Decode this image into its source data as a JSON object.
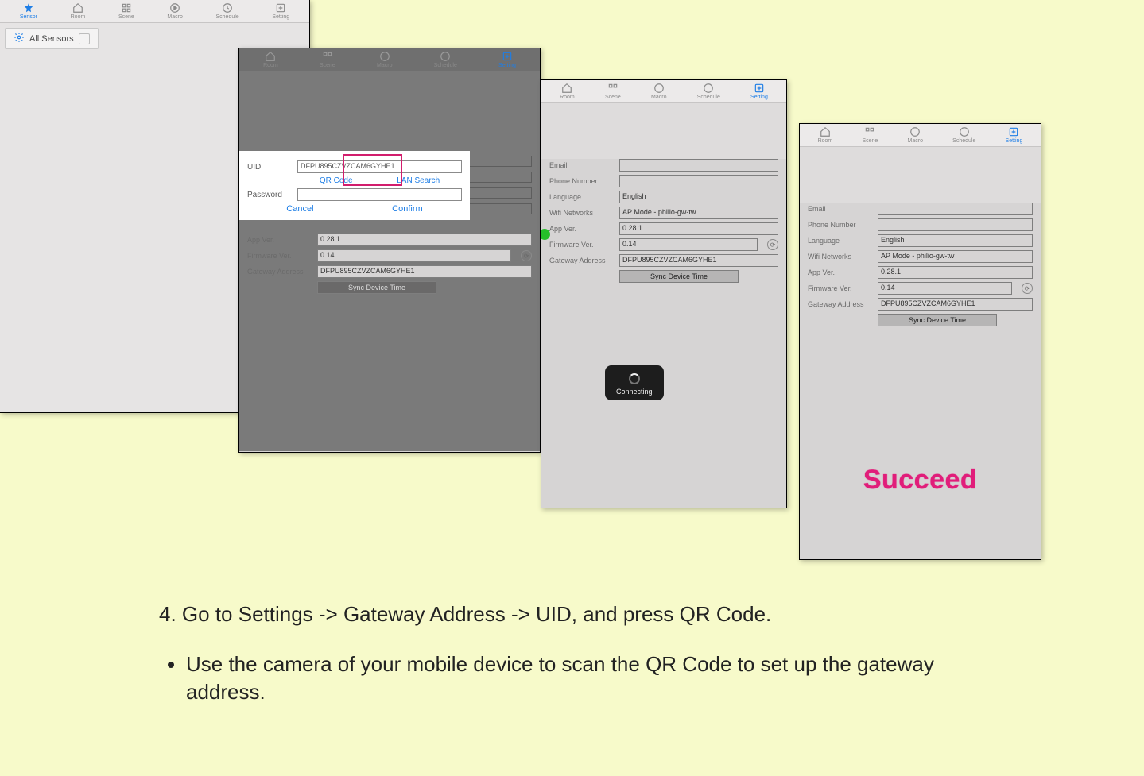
{
  "domain": "Document",
  "tabs": [
    {
      "key": "sensor",
      "label": "Sensor"
    },
    {
      "key": "room",
      "label": "Room"
    },
    {
      "key": "scene",
      "label": "Scene"
    },
    {
      "key": "macro",
      "label": "Macro"
    },
    {
      "key": "schedule",
      "label": "Schedule"
    },
    {
      "key": "setting",
      "label": "Setting"
    }
  ],
  "shot1": {
    "all_sensors_label": "All Sensors"
  },
  "dialog": {
    "uid_label": "UID",
    "uid_value": "DFPU895CZVZCAM6GYHE1",
    "qr_label": "QR Code",
    "lan_label": "LAN Search",
    "password_label": "Password",
    "password_value": "",
    "cancel": "Cancel",
    "confirm": "Confirm"
  },
  "shot2_below": {
    "app_ver_label": "App Ver.",
    "app_ver": "0.28.1",
    "fw_label": "Firmware Ver.",
    "fw": "0.14",
    "gw_label": "Gateway Address",
    "gw": "DFPU895CZVZCAM6GYHE1",
    "sync": "Sync Device Time"
  },
  "settings": {
    "email_label": "Email",
    "email": "",
    "phone_label": "Phone Number",
    "phone": "",
    "lang_label": "Language",
    "lang": "English",
    "wifi_label": "Wifi Networks",
    "wifi": "AP Mode - philio-gw-tw",
    "app_ver_label": "App Ver.",
    "app_ver": "0.28.1",
    "fw_label": "Firmware Ver.",
    "fw": "0.14",
    "gw_label": "Gateway Address",
    "gw": "DFPU895CZVZCAM6GYHE1",
    "sync": "Sync Device Time"
  },
  "toast": "Connecting",
  "succeed": "Succeed",
  "instructions": {
    "step": "4. Go to Settings -> Gateway Address -> UID, and press QR Code.",
    "bullet": "Use the camera of your mobile device to scan the QR Code to set up the gateway address."
  }
}
